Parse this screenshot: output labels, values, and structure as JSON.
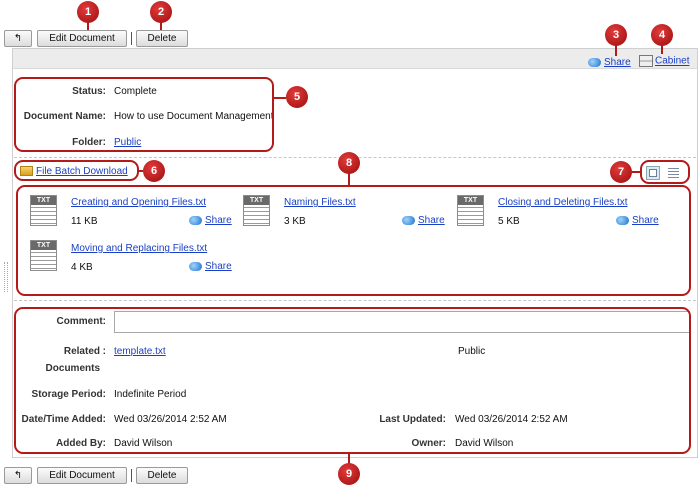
{
  "toolbar_top": {
    "back_label": "↰",
    "edit_label": "Edit Document",
    "delete_label": "Delete"
  },
  "toolbar_bottom": {
    "back_label": "↰",
    "edit_label": "Edit Document",
    "delete_label": "Delete"
  },
  "header": {
    "share_label": "Share",
    "cabinet_label": "Cabinet"
  },
  "details": {
    "status_label": "Status:",
    "status_value": "Complete",
    "name_label": "Document Name:",
    "name_value": "How to use Document Management",
    "folder_label": "Folder:",
    "folder_value": "Public"
  },
  "batch_download_label": "File Batch Download",
  "files": [
    {
      "name": "Creating and Opening Files.txt",
      "size": "11 KB",
      "share": "Share",
      "type": "TXT"
    },
    {
      "name": "Naming Files.txt",
      "size": "3 KB",
      "share": "Share",
      "type": "TXT"
    },
    {
      "name": "Closing and Deleting Files.txt",
      "size": "5 KB",
      "share": "Share",
      "type": "TXT"
    },
    {
      "name": "Moving and Replacing Files.txt",
      "size": "4 KB",
      "share": "Share",
      "type": "TXT"
    }
  ],
  "info": {
    "comment_label": "Comment:",
    "comment_value": "",
    "related_label_1": "Related",
    "related_label_2": "Documents",
    "related_colon": ":",
    "related_value": "template.txt",
    "related_folder": "Public",
    "storage_label": "Storage Period:",
    "storage_value": "Indefinite Period",
    "added_label": "Date/Time Added:",
    "added_value": "Wed 03/26/2014 2:52 AM",
    "updated_label": "Last Updated:",
    "updated_value": "Wed 03/26/2014 2:52 AM",
    "addedby_label": "Added By:",
    "addedby_value": "David Wilson",
    "owner_label": "Owner:",
    "owner_value": "David Wilson"
  },
  "callouts": [
    "1",
    "2",
    "3",
    "4",
    "5",
    "6",
    "7",
    "8",
    "9"
  ],
  "colors": {
    "accent_red": "#b31b1b",
    "link_blue": "#1a3fc4",
    "header_gray": "#ececec"
  }
}
